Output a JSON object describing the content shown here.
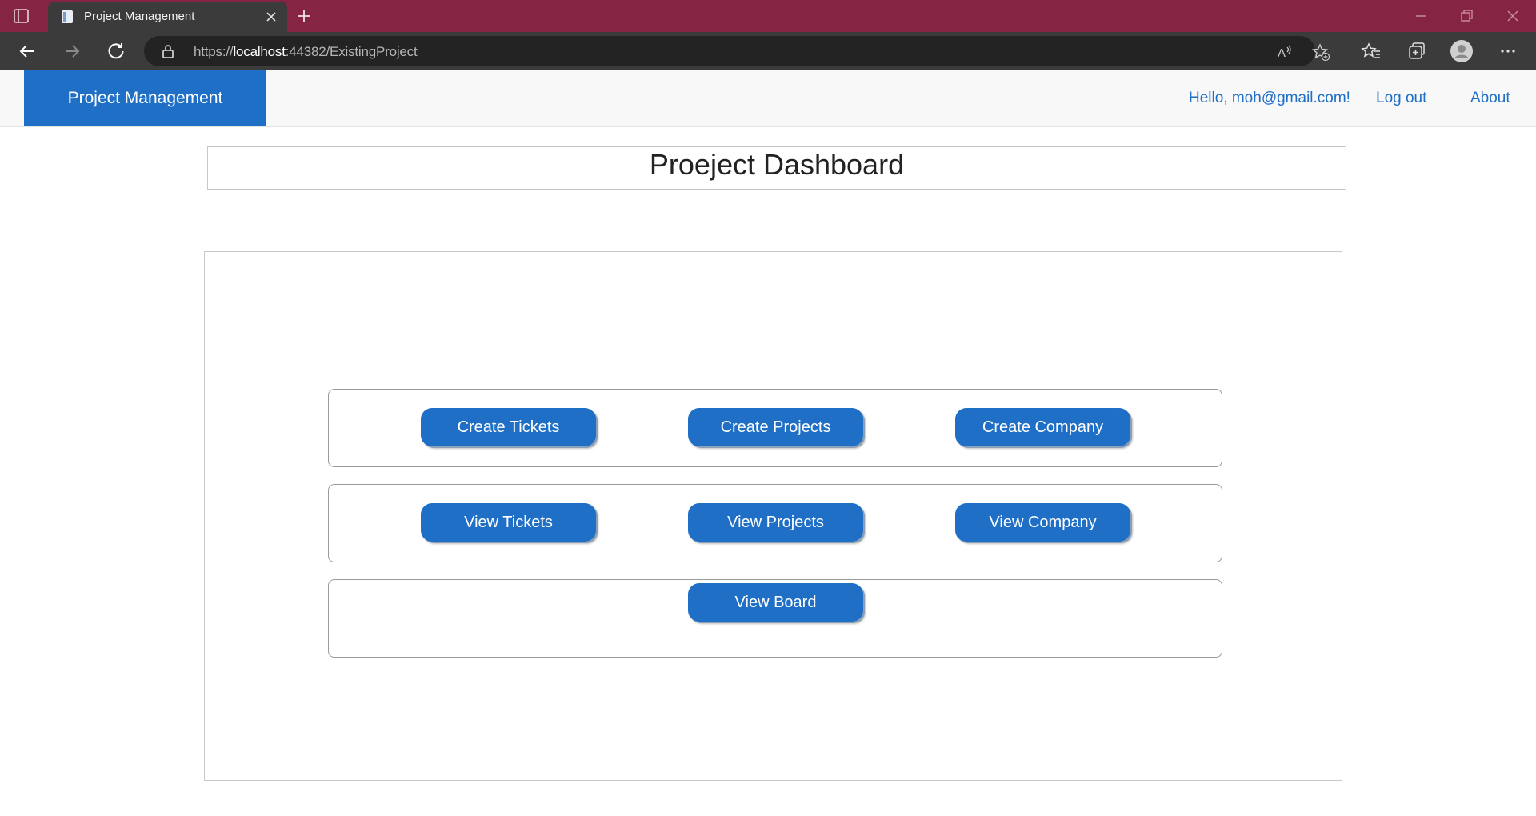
{
  "browser": {
    "tab_title": "Project Management",
    "url_scheme": "https://",
    "url_host": "localhost",
    "url_rest": ":44382/ExistingProject",
    "icons": [
      "tab-actions-icon",
      "page-icon",
      "close-icon",
      "plus-icon",
      "minimize-icon",
      "restore-icon",
      "window-close-icon",
      "back-icon",
      "forward-icon",
      "refresh-icon",
      "lock-icon",
      "read-aloud-icon",
      "add-favorite-icon",
      "favorites-icon",
      "collections-icon",
      "profile-icon",
      "more-icon"
    ]
  },
  "navbar": {
    "brand": "Project Management",
    "greeting": "Hello, moh@gmail.com!",
    "logout": "Log out",
    "about": "About",
    "brand_color": "#1f6fc6"
  },
  "page": {
    "title": "Proeject Dashboard"
  },
  "dashboard": {
    "create_row": [
      "Create Tickets",
      "Create Projects",
      "Create Company"
    ],
    "view_row": [
      "View Tickets",
      "View Projects",
      "View Company"
    ],
    "board_row": [
      "View Board"
    ]
  },
  "colors": {
    "tabbar": "#862443",
    "toolbar": "#3b3b3b",
    "button": "#1f6fc6"
  }
}
